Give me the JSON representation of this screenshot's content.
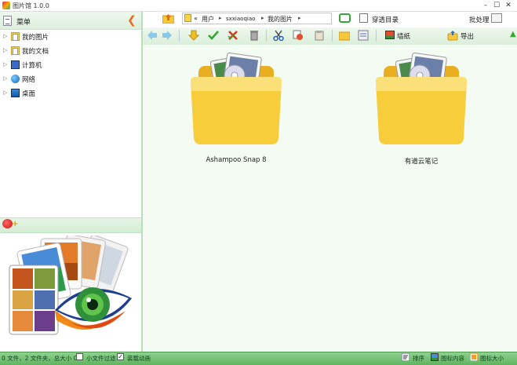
{
  "window": {
    "title": "图片馆 1.0.0",
    "controls": [
      "–",
      "☐",
      "✕"
    ]
  },
  "sidebar": {
    "menu_label": "菜单",
    "tree": [
      {
        "label": "我的图片",
        "icon": "pictures-folder-icon"
      },
      {
        "label": "我的文档",
        "icon": "documents-folder-icon"
      },
      {
        "label": "计算机",
        "icon": "computer-icon"
      },
      {
        "label": "网络",
        "icon": "network-icon"
      },
      {
        "label": "桌面",
        "icon": "desktop-icon"
      }
    ]
  },
  "toolbar": {
    "breadcrumb": {
      "prefix": "«",
      "items": [
        "用户",
        "sxxiaoqiao",
        "我的图片"
      ],
      "separator": "▸"
    },
    "through_dir_label": "穿透目录",
    "batch_label": "批处理",
    "wallpaper_label": "墙纸",
    "export_label": "导出"
  },
  "content": {
    "folders": [
      {
        "name": "Ashampoo Snap 8"
      },
      {
        "name": "有道云笔记"
      }
    ]
  },
  "statusbar": {
    "summary": "0 文件，2 文件夹，总大小 0",
    "small_file_filter_label": "小文件过滤",
    "small_file_filter_checked": false,
    "load_animation_label": "装载动画",
    "load_animation_checked": true,
    "sort_label": "排序",
    "icon_content_label": "图标内容",
    "icon_size_label": "图标大小"
  },
  "colors": {
    "accent_green": "#5fb35f",
    "panel_green": "#dcefdc",
    "folder_yellow": "#f5c93a"
  }
}
